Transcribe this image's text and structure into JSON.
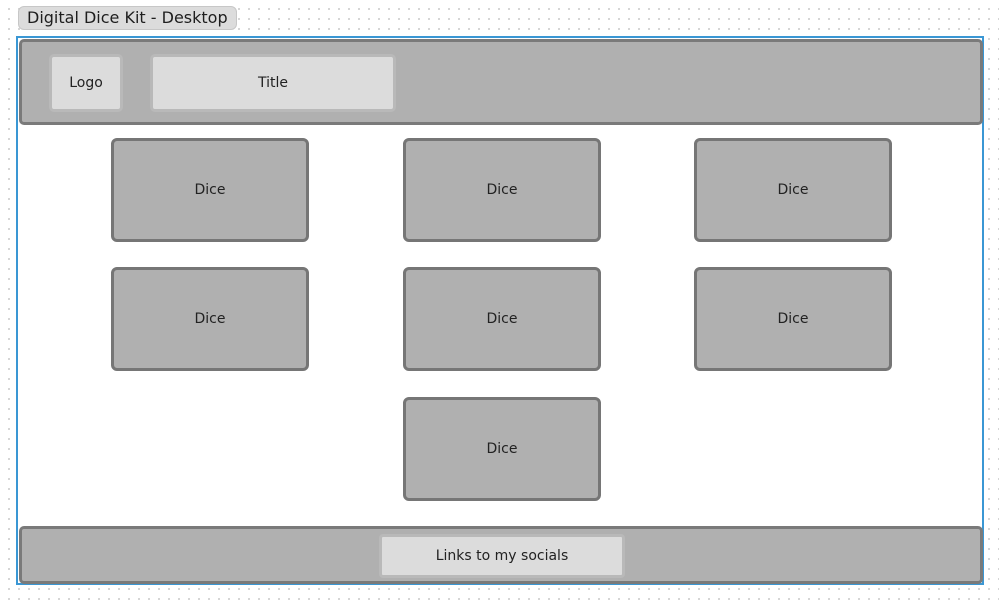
{
  "frame": {
    "label": "Digital Dice Kit - Desktop"
  },
  "header": {
    "logo": "Logo",
    "title": "Title"
  },
  "dice": [
    {
      "label": "Dice"
    },
    {
      "label": "Dice"
    },
    {
      "label": "Dice"
    },
    {
      "label": "Dice"
    },
    {
      "label": "Dice"
    },
    {
      "label": "Dice"
    },
    {
      "label": "Dice"
    }
  ],
  "footer": {
    "socials_label": "Links to my socials"
  },
  "colors": {
    "frame_border": "#3a97d4",
    "panel_fill": "#b0b0b0",
    "panel_border": "#7a7a7a",
    "inner_box_fill": "#dcdcdc"
  }
}
